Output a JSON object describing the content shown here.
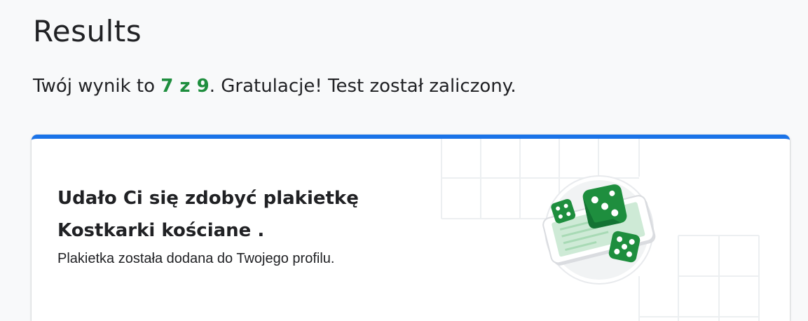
{
  "page": {
    "title": "Results"
  },
  "result": {
    "prefix": "Twój wynik to",
    "score": "7 z 9",
    "suffix": ". Gratulacje! Test został zaliczony."
  },
  "badge_card": {
    "heading": "Udało Ci się zdobyć plakietkę",
    "badge_name": "Kostkarki kościane .",
    "note": "Plakietka została dodana do Twojego profilu.",
    "icon": "dice-badge-icon",
    "accent_color": "#1a73e8",
    "badge_color": "#1e8e3e"
  }
}
